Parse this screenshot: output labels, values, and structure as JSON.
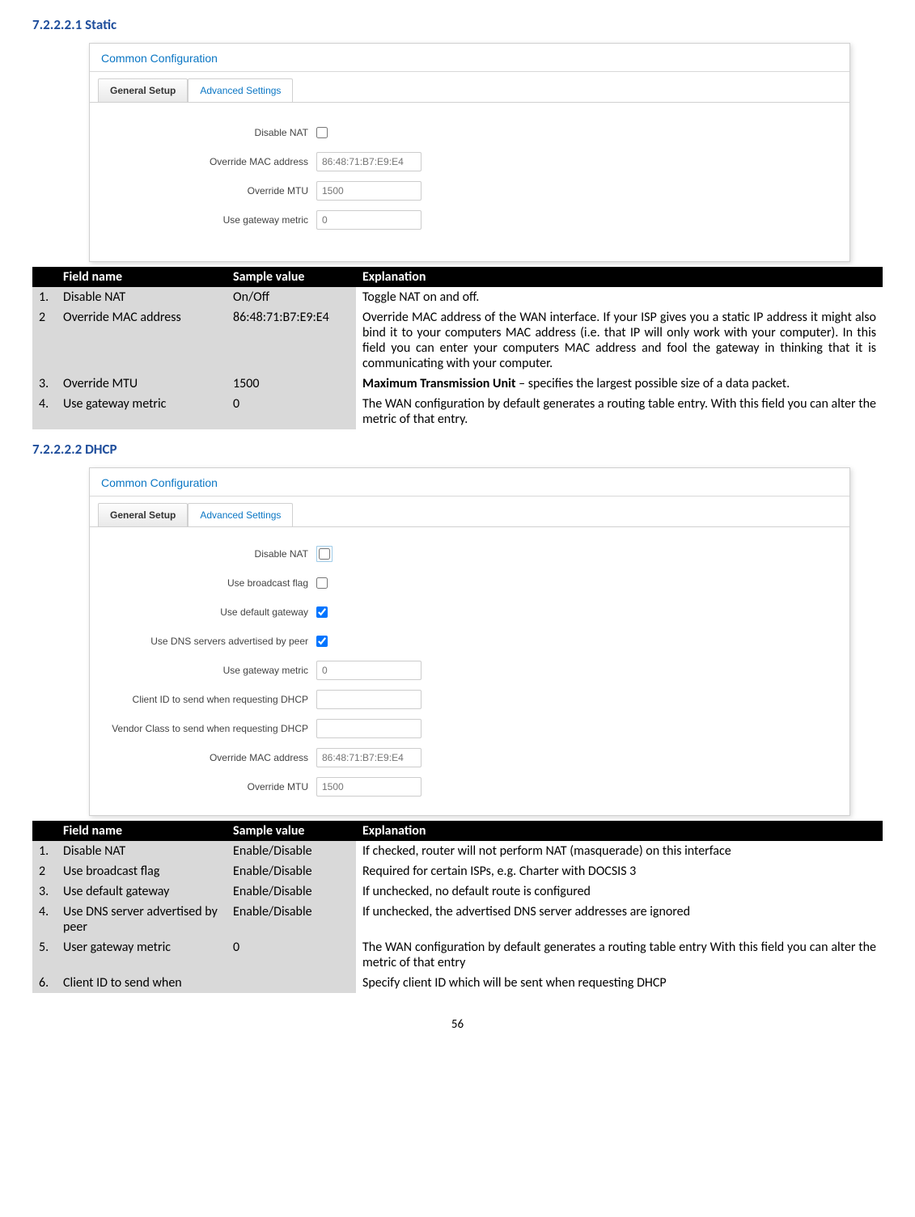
{
  "section1": {
    "heading": "7.2.2.2.1  Static",
    "panel_title": "Common Configuration",
    "tab1": "General Setup",
    "tab2": "Advanced Settings",
    "fields": {
      "disable_nat_label": "Disable NAT",
      "override_mac_label": "Override MAC address",
      "override_mac_placeholder": "86:48:71:B7:E9:E4",
      "override_mtu_label": "Override MTU",
      "override_mtu_placeholder": "1500",
      "gateway_metric_label": "Use gateway metric",
      "gateway_metric_placeholder": "0"
    }
  },
  "table1": {
    "header": {
      "num": "",
      "f": "Field name",
      "s": "Sample value",
      "e": "Explanation"
    },
    "rows": [
      {
        "n": "1.",
        "f": "Disable NAT",
        "s": "On/Off",
        "e": "Toggle NAT on and off."
      },
      {
        "n": "2",
        "f": "Override MAC address",
        "s": "86:48:71:B7:E9:E4",
        "e": "Override MAC address of the WAN interface. If your ISP gives you a static IP address it might also bind it to your computers MAC address (i.e. that IP will only work with your computer). In this field you can enter your computers MAC address and fool the gateway in thinking that it is communicating with your computer."
      },
      {
        "n": "3.",
        "f": "Override MTU",
        "s": "1500",
        "e_bold": "Maximum Transmission Unit",
        "e_rest": " – specifies the largest possible size of a data packet."
      },
      {
        "n": "4.",
        "f": "Use gateway metric",
        "s": "0",
        "e": "The WAN configuration by default generates a routing table entry. With this field you can alter the metric of that entry."
      }
    ]
  },
  "section2": {
    "heading": "7.2.2.2.2  DHCP",
    "panel_title": "Common Configuration",
    "tab1": "General Setup",
    "tab2": "Advanced Settings",
    "fields": {
      "disable_nat_label": "Disable NAT",
      "broadcast_label": "Use broadcast flag",
      "default_gw_label": "Use default gateway",
      "dns_peer_label": "Use DNS servers advertised by peer",
      "gateway_metric_label": "Use gateway metric",
      "gateway_metric_placeholder": "0",
      "client_id_label": "Client ID to send when requesting DHCP",
      "vendor_class_label": "Vendor Class to send when requesting DHCP",
      "override_mac_label": "Override MAC address",
      "override_mac_placeholder": "86:48:71:B7:E9:E4",
      "override_mtu_label": "Override MTU",
      "override_mtu_placeholder": "1500"
    }
  },
  "table2": {
    "header": {
      "num": "",
      "f": "Field name",
      "s": "Sample value",
      "e": "Explanation"
    },
    "rows": [
      {
        "n": "1.",
        "f": "Disable NAT",
        "s": "Enable/Disable",
        "e": "If checked, router will not perform NAT (masquerade) on this interface"
      },
      {
        "n": "2",
        "f": "Use broadcast flag",
        "s": "Enable/Disable",
        "e": "Required for certain ISPs, e.g. Charter with DOCSIS 3"
      },
      {
        "n": "3.",
        "f": "Use default gateway",
        "s": "Enable/Disable",
        "e": "If unchecked, no default route is configured"
      },
      {
        "n": "4.",
        "f": "Use DNS server advertised by peer",
        "s": "Enable/Disable",
        "e": "If unchecked, the advertised DNS server addresses are ignored"
      },
      {
        "n": "5.",
        "f": "User gateway metric",
        "s": "0",
        "e": "The WAN configuration by default generates a routing table entry With this field you can alter the metric of that entry"
      },
      {
        "n": "6.",
        "f": "Client ID to send when",
        "s": "",
        "e": "Specify client ID which will be sent when requesting DHCP"
      }
    ]
  },
  "page_number": "56"
}
